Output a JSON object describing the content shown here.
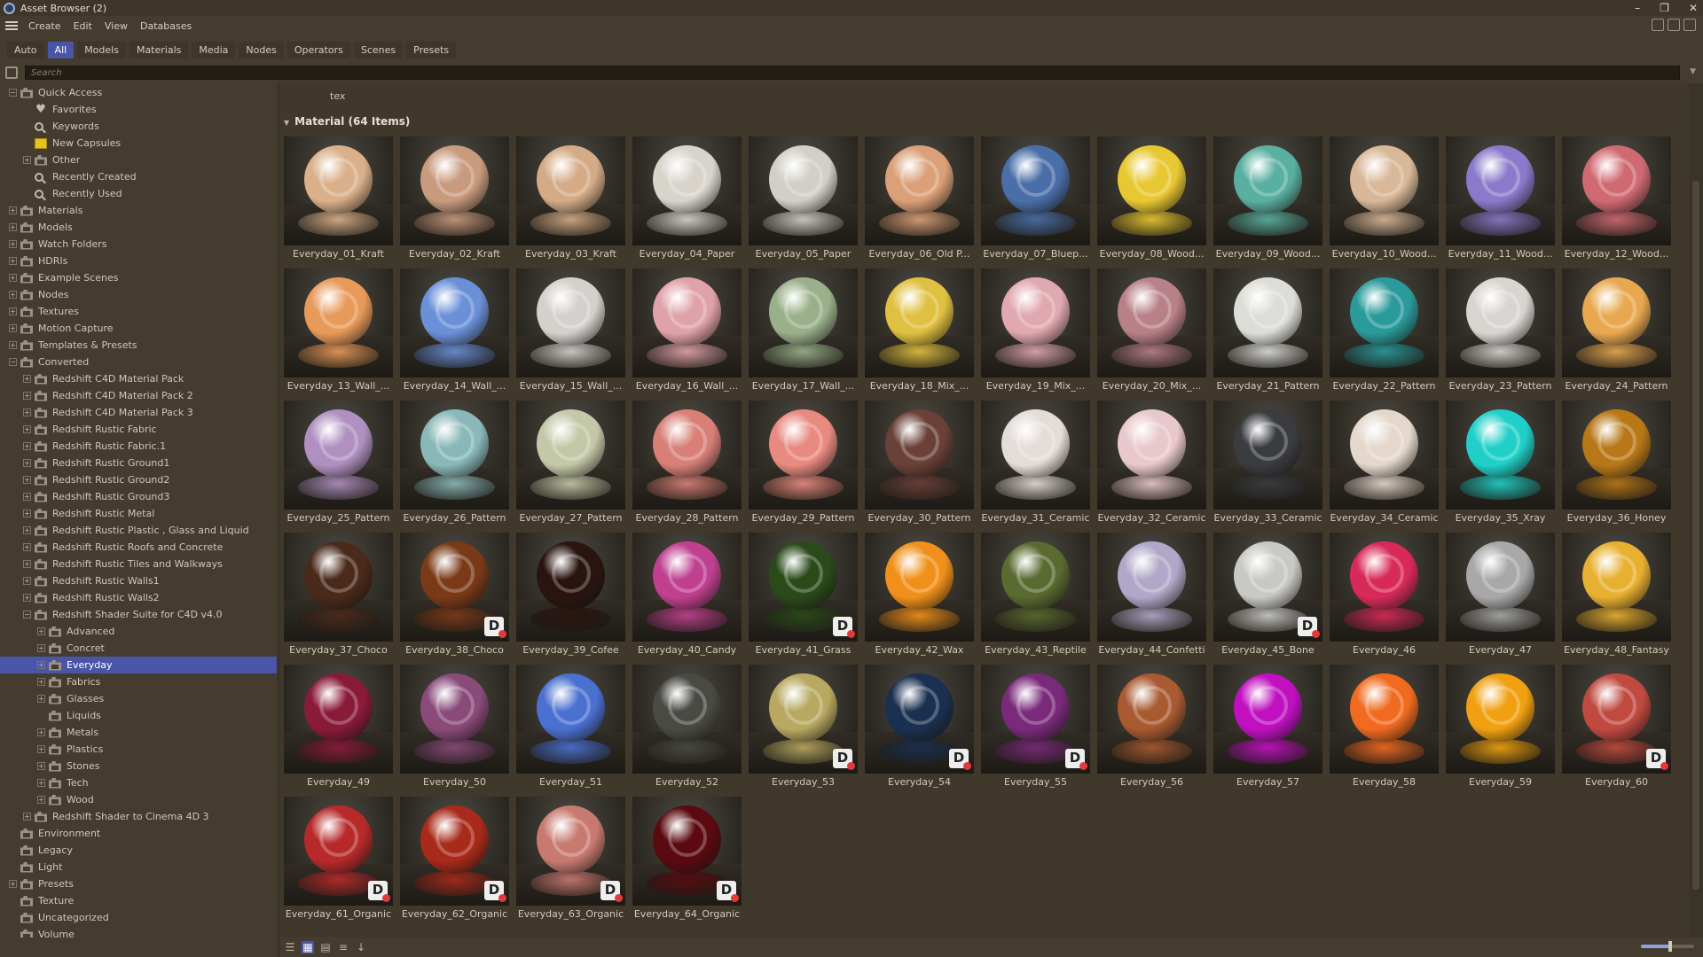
{
  "window": {
    "title": "Asset Browser (2)",
    "controls": [
      "–",
      "❐",
      "✕"
    ]
  },
  "menu": [
    "Create",
    "Edit",
    "View",
    "Databases"
  ],
  "tabs": [
    {
      "label": "Auto",
      "active": false
    },
    {
      "label": "All",
      "active": true
    },
    {
      "label": "Models",
      "active": false
    },
    {
      "label": "Materials",
      "active": false
    },
    {
      "label": "Media",
      "active": false
    },
    {
      "label": "Nodes",
      "active": false
    },
    {
      "label": "Operators",
      "active": false
    },
    {
      "label": "Scenes",
      "active": false
    },
    {
      "label": "Presets",
      "active": false
    }
  ],
  "search": {
    "placeholder": "Search",
    "value": ""
  },
  "tree": [
    {
      "label": "Quick Access",
      "depth": 0,
      "expander": "−",
      "icon": "folder-icon"
    },
    {
      "label": "Favorites",
      "depth": 1,
      "expander": "",
      "icon": "heart-icon"
    },
    {
      "label": "Keywords",
      "depth": 1,
      "expander": "",
      "icon": "search-icon"
    },
    {
      "label": "New Capsules",
      "depth": 1,
      "expander": "",
      "icon": "capsule-icon"
    },
    {
      "label": "Other",
      "depth": 1,
      "expander": "+",
      "icon": "folder-icon"
    },
    {
      "label": "Recently Created",
      "depth": 1,
      "expander": "",
      "icon": "search-icon"
    },
    {
      "label": "Recently Used",
      "depth": 1,
      "expander": "",
      "icon": "search-icon"
    },
    {
      "label": "Materials",
      "depth": 0,
      "expander": "+",
      "icon": "folder-icon"
    },
    {
      "label": "Models",
      "depth": 0,
      "expander": "+",
      "icon": "folder-icon"
    },
    {
      "label": "Watch Folders",
      "depth": 0,
      "expander": "+",
      "icon": "folder-icon"
    },
    {
      "label": "HDRIs",
      "depth": 0,
      "expander": "+",
      "icon": "folder-icon"
    },
    {
      "label": "Example Scenes",
      "depth": 0,
      "expander": "+",
      "icon": "folder-icon"
    },
    {
      "label": "Nodes",
      "depth": 0,
      "expander": "+",
      "icon": "folder-icon"
    },
    {
      "label": "Textures",
      "depth": 0,
      "expander": "+",
      "icon": "folder-icon"
    },
    {
      "label": "Motion Capture",
      "depth": 0,
      "expander": "+",
      "icon": "folder-icon"
    },
    {
      "label": "Templates & Presets",
      "depth": 0,
      "expander": "+",
      "icon": "folder-icon"
    },
    {
      "label": "Converted",
      "depth": 0,
      "expander": "−",
      "icon": "folder-icon"
    },
    {
      "label": "Redshift C4D Material Pack",
      "depth": 1,
      "expander": "+",
      "icon": "folder-icon"
    },
    {
      "label": "Redshift C4D Material Pack 2",
      "depth": 1,
      "expander": "+",
      "icon": "folder-icon"
    },
    {
      "label": "Redshift C4D Material Pack 3",
      "depth": 1,
      "expander": "+",
      "icon": "folder-icon"
    },
    {
      "label": "Redshift Rustic Fabric",
      "depth": 1,
      "expander": "+",
      "icon": "folder-icon"
    },
    {
      "label": "Redshift Rustic Fabric.1",
      "depth": 1,
      "expander": "+",
      "icon": "folder-icon"
    },
    {
      "label": "Redshift Rustic Ground1",
      "depth": 1,
      "expander": "+",
      "icon": "folder-icon"
    },
    {
      "label": "Redshift Rustic Ground2",
      "depth": 1,
      "expander": "+",
      "icon": "folder-icon"
    },
    {
      "label": "Redshift Rustic Ground3",
      "depth": 1,
      "expander": "+",
      "icon": "folder-icon"
    },
    {
      "label": "Redshift Rustic Metal",
      "depth": 1,
      "expander": "+",
      "icon": "folder-icon"
    },
    {
      "label": "Redshift Rustic Plastic , Glass and Liquid",
      "depth": 1,
      "expander": "+",
      "icon": "folder-icon"
    },
    {
      "label": "Redshift Rustic Roofs and Concrete",
      "depth": 1,
      "expander": "+",
      "icon": "folder-icon"
    },
    {
      "label": "Redshift Rustic Tiles and Walkways",
      "depth": 1,
      "expander": "+",
      "icon": "folder-icon"
    },
    {
      "label": "Redshift Rustic Walls1",
      "depth": 1,
      "expander": "+",
      "icon": "folder-icon"
    },
    {
      "label": "Redshift Rustic Walls2",
      "depth": 1,
      "expander": "+",
      "icon": "folder-icon"
    },
    {
      "label": "Redshift Shader Suite for C4D v4.0",
      "depth": 1,
      "expander": "−",
      "icon": "folder-icon"
    },
    {
      "label": "Advanced",
      "depth": 2,
      "expander": "+",
      "icon": "folder-icon"
    },
    {
      "label": "Concret",
      "depth": 2,
      "expander": "+",
      "icon": "folder-icon"
    },
    {
      "label": "Everyday",
      "depth": 2,
      "expander": "+",
      "icon": "folder-icon",
      "selected": true
    },
    {
      "label": "Fabrics",
      "depth": 2,
      "expander": "+",
      "icon": "folder-icon"
    },
    {
      "label": "Glasses",
      "depth": 2,
      "expander": "+",
      "icon": "folder-icon"
    },
    {
      "label": "Liquids",
      "depth": 2,
      "expander": "",
      "icon": "folder-icon"
    },
    {
      "label": "Metals",
      "depth": 2,
      "expander": "+",
      "icon": "folder-icon"
    },
    {
      "label": "Plastics",
      "depth": 2,
      "expander": "+",
      "icon": "folder-icon"
    },
    {
      "label": "Stones",
      "depth": 2,
      "expander": "+",
      "icon": "folder-icon"
    },
    {
      "label": "Tech",
      "depth": 2,
      "expander": "+",
      "icon": "folder-icon"
    },
    {
      "label": "Wood",
      "depth": 2,
      "expander": "+",
      "icon": "folder-icon"
    },
    {
      "label": "Redshift Shader to Cinema 4D 3",
      "depth": 1,
      "expander": "+",
      "icon": "folder-icon"
    },
    {
      "label": "Environment",
      "depth": 0,
      "expander": "",
      "icon": "folder-icon"
    },
    {
      "label": "Legacy",
      "depth": 0,
      "expander": "",
      "icon": "folder-icon"
    },
    {
      "label": "Light",
      "depth": 0,
      "expander": "",
      "icon": "folder-icon"
    },
    {
      "label": "Presets",
      "depth": 0,
      "expander": "+",
      "icon": "folder-icon"
    },
    {
      "label": "Texture",
      "depth": 0,
      "expander": "",
      "icon": "folder-icon"
    },
    {
      "label": "Uncategorized",
      "depth": 0,
      "expander": "",
      "icon": "folder-icon"
    },
    {
      "label": "Volume",
      "depth": 0,
      "expander": "",
      "icon": "folder-icon"
    }
  ],
  "content": {
    "filter_text": "tex",
    "group_header": "Material (64 Items)",
    "badge_letter": "D",
    "items": [
      {
        "name": "Everyday_01_Kraft",
        "color": "#d9b08a"
      },
      {
        "name": "Everyday_02_Kraft",
        "color": "#c89a7e"
      },
      {
        "name": "Everyday_03_Kraft",
        "color": "#d4ab86"
      },
      {
        "name": "Everyday_04_Paper",
        "color": "#d8d4cc"
      },
      {
        "name": "Everyday_05_Paper",
        "color": "#d2cec8"
      },
      {
        "name": "Everyday_06_Old P...",
        "color": "#dba078"
      },
      {
        "name": "Everyday_07_Bluep...",
        "color": "#4a6ea8"
      },
      {
        "name": "Everyday_08_Wood...",
        "color": "#e8c832"
      },
      {
        "name": "Everyday_09_Wood...",
        "color": "#5ab0a0"
      },
      {
        "name": "Everyday_10_Wood...",
        "color": "#d8b898"
      },
      {
        "name": "Everyday_11_Wood...",
        "color": "#8a7acb"
      },
      {
        "name": "Everyday_12_Wood...",
        "color": "#d06a72"
      },
      {
        "name": "Everyday_13_Wall_...",
        "color": "#e89a5a"
      },
      {
        "name": "Everyday_14_Wall_...",
        "color": "#6a90d8"
      },
      {
        "name": "Everyday_15_Wall_...",
        "color": "#d4d0cc"
      },
      {
        "name": "Everyday_16_Wall_...",
        "color": "#e0a2aa"
      },
      {
        "name": "Everyday_17_Wall_...",
        "color": "#9ab08a"
      },
      {
        "name": "Everyday_18_Mix_...",
        "color": "#e0c040"
      },
      {
        "name": "Everyday_19_Mix_...",
        "color": "#e0a8b0"
      },
      {
        "name": "Everyday_20_Mix_...",
        "color": "#b88088"
      },
      {
        "name": "Everyday_21_Pattern",
        "color": "#dcdcd8"
      },
      {
        "name": "Everyday_22_Pattern",
        "color": "#2a9a9a"
      },
      {
        "name": "Everyday_23_Pattern",
        "color": "#d8d4d0"
      },
      {
        "name": "Everyday_24_Pattern",
        "color": "#e8a850"
      },
      {
        "name": "Everyday_25_Pattern",
        "color": "#b090c0"
      },
      {
        "name": "Everyday_26_Pattern",
        "color": "#8ab8b8"
      },
      {
        "name": "Everyday_27_Pattern",
        "color": "#c4c8a8"
      },
      {
        "name": "Everyday_28_Pattern",
        "color": "#d88078"
      },
      {
        "name": "Everyday_29_Pattern",
        "color": "#e88a80"
      },
      {
        "name": "Everyday_30_Pattern",
        "color": "#6a4038"
      },
      {
        "name": "Everyday_31_Ceramic",
        "color": "#e4dcd8"
      },
      {
        "name": "Everyday_32_Ceramic",
        "color": "#e8c8cc"
      },
      {
        "name": "Everyday_33_Ceramic",
        "color": "#3a3c40"
      },
      {
        "name": "Everyday_34_Ceramic",
        "color": "#e4d8cc"
      },
      {
        "name": "Everyday_35_Xray",
        "color": "#20d0c8"
      },
      {
        "name": "Everyday_36_Honey",
        "color": "#b87818"
      },
      {
        "name": "Everyday_37_Choco",
        "color": "#4a2a1a"
      },
      {
        "name": "Everyday_38_Choco",
        "color": "#7a3a18"
      },
      {
        "name": "Everyday_39_Cofee",
        "color": "#2a1410"
      },
      {
        "name": "Everyday_40_Candy",
        "color": "#c04090"
      },
      {
        "name": "Everyday_41_Grass",
        "color": "#2a4a1a"
      },
      {
        "name": "Everyday_42_Wax",
        "color": "#f0901a"
      },
      {
        "name": "Everyday_43_Reptile",
        "color": "#5a6a30"
      },
      {
        "name": "Everyday_44_Confetti",
        "color": "#b0a8c8"
      },
      {
        "name": "Everyday_45_Bone",
        "color": "#c8c8c4"
      },
      {
        "name": "Everyday_46",
        "color": "#d82a5a"
      },
      {
        "name": "Everyday_47",
        "color": "#a8a8a8"
      },
      {
        "name": "Everyday_48_Fantasy",
        "color": "#e8b030"
      },
      {
        "name": "Everyday_49",
        "color": "#8a1a3a"
      },
      {
        "name": "Everyday_50",
        "color": "#8a4a7a"
      },
      {
        "name": "Everyday_51",
        "color": "#4a70d0"
      },
      {
        "name": "Everyday_52",
        "color": "#4a4a44"
      },
      {
        "name": "Everyday_53",
        "color": "#b8a860"
      },
      {
        "name": "Everyday_54",
        "color": "#1a3050"
      },
      {
        "name": "Everyday_55",
        "color": "#7a2a7a"
      },
      {
        "name": "Everyday_56",
        "color": "#a85a30"
      },
      {
        "name": "Everyday_57",
        "color": "#c010c0"
      },
      {
        "name": "Everyday_58",
        "color": "#f06a20"
      },
      {
        "name": "Everyday_59",
        "color": "#f0a010"
      },
      {
        "name": "Everyday_60",
        "color": "#c04a40"
      },
      {
        "name": "Everyday_61_Organic",
        "color": "#b82a2a"
      },
      {
        "name": "Everyday_62_Organic",
        "color": "#a82a1a"
      },
      {
        "name": "Everyday_63_Organic",
        "color": "#c87a70"
      },
      {
        "name": "Everyday_64_Organic",
        "color": "#5a0a10"
      }
    ],
    "badged": [
      "Everyday_38_Choco",
      "Everyday_41_Grass",
      "Everyday_45_Bone",
      "Everyday_53",
      "Everyday_54",
      "Everyday_55",
      "Everyday_60",
      "Everyday_61_Organic",
      "Everyday_62_Organic",
      "Everyday_63_Organic",
      "Everyday_64_Organic"
    ]
  },
  "bottom": {
    "icons": [
      "list-view-icon",
      "grid-view-icon",
      "small-grid-icon",
      "detail-list-icon",
      "sort-down-icon"
    ],
    "zoom": 0.55
  },
  "colors": {
    "accent": "#4a55a8",
    "panel": "#443d2f",
    "content": "#3f382b"
  }
}
